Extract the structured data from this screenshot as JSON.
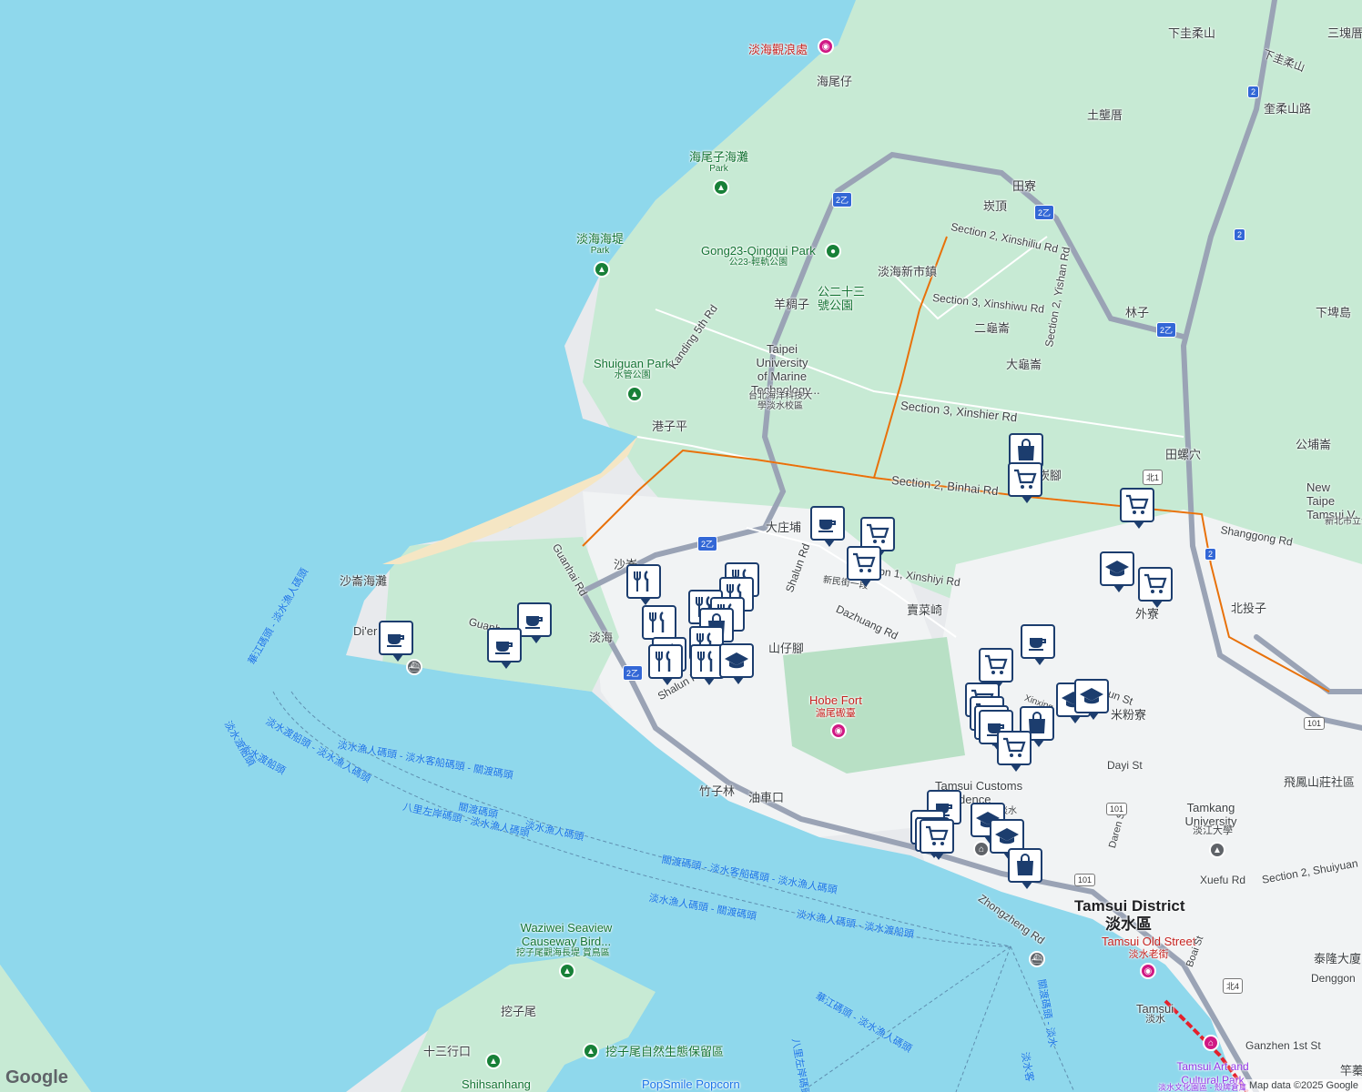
{
  "colors": {
    "water": "#8fd8ec",
    "land": "#e8eaed",
    "green": "#c7ead4",
    "urban": "#f1f3f4",
    "sand": "#f5e6c4",
    "road": "#9aa3b5",
    "rail": "#e8710a",
    "pin_border": "#1c3d6e"
  },
  "labels": {
    "tanhai_wave": "淡海觀浪處",
    "haiweizai": "海尾仔",
    "haiweizai_beach": "海尾子海灘",
    "park": "Park",
    "tanhai_dike": "淡海海堤",
    "gong23": "Gong23-Qingqui Park",
    "gong23_zh": "公23-輕軌公園",
    "tanhai_new": "淡海新市鎮",
    "gong23_park_zh": "公二十三號公園",
    "yangtiaozi": "羊稠子",
    "taipei_univ": "Taipei University of Marine Technology...",
    "taipei_univ_zh": "台北海洋科技大學淡水校區",
    "shuiguan": "Shuiguan Park",
    "shuiguan_zh": "水管公園",
    "kanding": "Kanding 5th Rd",
    "gangziping": "港子平",
    "xinshiliu": "Section 2, Xinshiliu Rd",
    "xinshiwu": "Section 3, Xinshiwu Rd",
    "xinshier": "Section 3, Xinshier Rd",
    "yishan": "Section 2, Yishan Rd",
    "binhai": "Section 2, Binhai Rd",
    "tianliao": "田寮",
    "tanding": "崁頂",
    "erguicuo": "二龜崙",
    "daguicuo": "大龜崙",
    "linzi": "林子",
    "xiazhuliu": "下圭柔山",
    "xiazhuliu2": "下圭柔山",
    "sankuaicuo": "三塊厝",
    "tulongcuo": "土壟厝",
    "kuirou": "奎柔山路",
    "xiabeidao": "下埤島",
    "tianluoxue": "田螺穴",
    "gongpucuo": "公埔崙",
    "newtaipei": "New Taipe Tamsui V",
    "newtaipei_zh": "新北市立淡水商工職",
    "shanggong": "Shanggong Rd",
    "beitouzi": "北投子",
    "waiiao": "外寮",
    "tanjiao": "崁腳",
    "dazhuangpu": "大庄埔",
    "shalunrd": "Shalun Rd",
    "xinshiyi": "Section 1, Xinshiyi Rd",
    "xinminjie": "新民街一段",
    "dazhuang": "Dazhuang Rd",
    "maicaiqi": "賣菜崎",
    "shazijiao": "山仔腳",
    "shalun_ab": "沙崙",
    "shalun_beach": "沙崙海灘",
    "guanhai": "Guanhai Rd",
    "tanhai": "淡海",
    "shalun2": "Shalun R",
    "dier": "Di'er Y",
    "guanh2": "Guanh",
    "hobe": "Hobe Fort",
    "hobe_zh": "滬尾礮臺",
    "zhuzilin": "竹子林",
    "youchekou": "油車口",
    "customs": "Tamsui Customs Residence",
    "customs_zh": "淡水",
    "mifenliao": "米粉寮",
    "xinxing": "Xinxing",
    "unst": "un St",
    "dayist": "Dayi St",
    "darenst": "Daren St",
    "tamkang": "Tamkang University",
    "tamkang_zh": "淡江大學",
    "shuiyuan": "Section 2, Shuiyuan",
    "xueyu": "Xuefu Rd",
    "feifeng": "飛鳳山莊社區",
    "tailong": "泰隆大廈",
    "dengong": "Denggon",
    "tamsui_district": "Tamsui District",
    "tamsui_district_zh": "淡水區",
    "old_street": "Tamsui Old Street",
    "old_street_zh": "淡水老街",
    "zhongzheng": "Zhongzheng Rd",
    "boaist": "Boai St",
    "tamsui": "Tamsui",
    "tamsui_zh": "淡水",
    "ganzhen": "Ganzhen 1st St",
    "ganzhen_zh": "竿蓁",
    "art_park": "Tamsui Art and Cultural Park",
    "art_park_zh": "淡水文化園區 - 殼牌倉庫",
    "waziwei": "Waziwei Seaview Causeway Bird...",
    "waziwei_zh": "挖子尾觀海長堤 賞鳥區",
    "waziwei_v": "挖子尾",
    "shisanhang": "十三行口",
    "shisanhang_park": "Shihsanhang",
    "waziwei_eco": "挖子尾自然生態保留區",
    "popsmile": "PopSmile Popcorn",
    "ferry1": "華江碼頭 - 淡水漁人碼頭",
    "ferry2": "淡水渡船頭",
    "ferry3": "淡水漁人碼頭 - 淡水客船碼頭 - 關渡碼頭",
    "ferry4": "淡水渡船頭 - 淡水漁人碼頭",
    "ferry5": "八里左岸碼頭 - 淡水漁人碼頭",
    "ferry6": "關渡碼頭 - 淡水客船碼頭 - 淡水漁人碼頭",
    "ferry7": "淡水漁人碼頭 - 關渡碼頭",
    "ferry8": "淡水漁人碼頭 - 淡水渡船頭",
    "ferry9": "華江碼頭 - 淡水漁人碼頭",
    "ferry10": "八里左岸碼頭",
    "ferry11": "關渡碼頭 - 淡水",
    "ferry12": "淡水客",
    "ferry13": "關渡碼頭",
    "ferry14": "淡水漁人碼頭",
    "ferry15": "淡水渡船頭"
  },
  "shields": [
    "2乙",
    "2乙",
    "2乙",
    "2乙",
    "2乙",
    "2",
    "2",
    "2",
    "北1",
    "101",
    "101",
    "101",
    "北4"
  ],
  "google": "Google",
  "attribution": "Map data ©2025 Google"
}
